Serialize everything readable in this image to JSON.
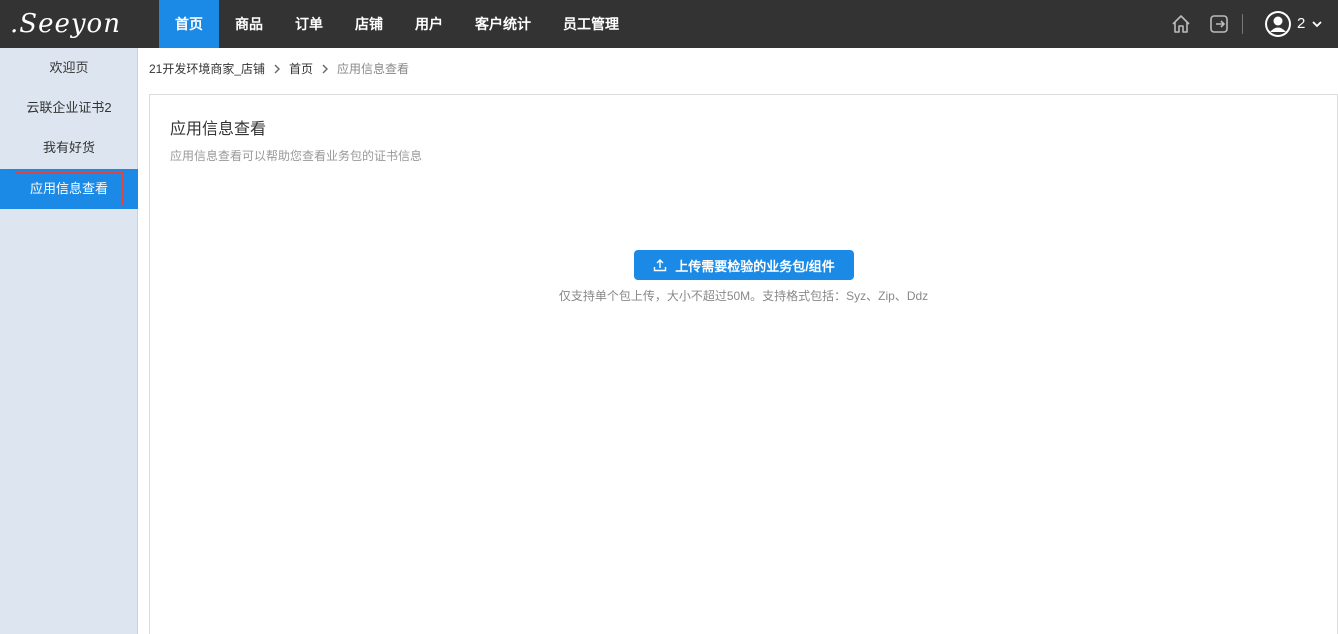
{
  "brand": {
    "logo_text": ".Seeyon"
  },
  "nav": {
    "items": [
      {
        "label": "首页"
      },
      {
        "label": "商品"
      },
      {
        "label": "订单"
      },
      {
        "label": "店铺"
      },
      {
        "label": "用户"
      },
      {
        "label": "客户统计"
      },
      {
        "label": "员工管理"
      }
    ],
    "active_index": 0
  },
  "user": {
    "name": "2"
  },
  "icons": {
    "home": "home-icon",
    "logout": "logout-icon",
    "avatar": "user-avatar-icon",
    "dropdown": "chevron-down-icon",
    "upload": "upload-icon",
    "breadcrumb_sep": "chevron-right-icon"
  },
  "sidebar": {
    "items": [
      {
        "label": "欢迎页"
      },
      {
        "label": "云联企业证书2"
      },
      {
        "label": "我有好货"
      },
      {
        "label": "应用信息查看"
      }
    ],
    "active_index": 3
  },
  "breadcrumb": {
    "items": [
      "21开发环境商家_店铺",
      "首页",
      "应用信息查看"
    ]
  },
  "main": {
    "title": "应用信息查看",
    "description": "应用信息查看可以帮助您查看业务包的证书信息",
    "upload_button": "上传需要检验的业务包/组件",
    "upload_hint": "仅支持单个包上传，大小不超过50M。支持格式包括：Syz、Zip、Ddz"
  },
  "colors": {
    "topbar": "#333333",
    "accent": "#1a8ae6",
    "sidebar_bg": "#dde6f0",
    "highlight_border": "#e0443e"
  }
}
